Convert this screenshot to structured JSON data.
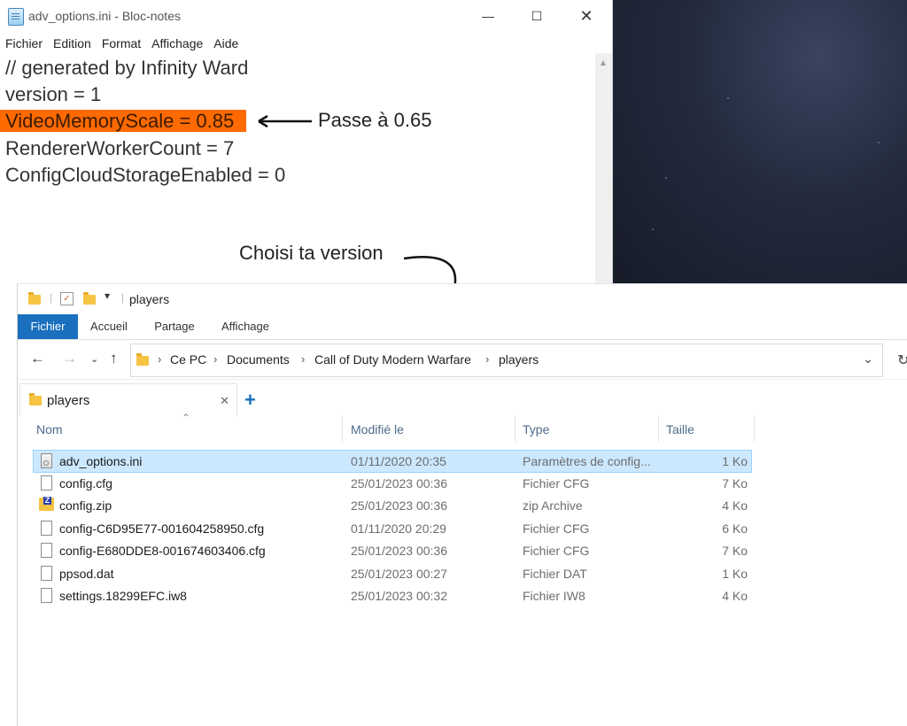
{
  "notepad": {
    "title": "adv_options.ini - Bloc-notes",
    "menu": [
      "Fichier",
      "Edition",
      "Format",
      "Affichage",
      "Aide"
    ],
    "lines": [
      "// generated by Infinity Ward",
      "version = 1",
      "VideoMemoryScale = 0.85",
      "RendererWorkerCount = 7",
      "ConfigCloudStorageEnabled = 0"
    ],
    "highlight_color": "#ff6a00"
  },
  "annotations": {
    "pass_value": "Passe à 0.65",
    "choose_version": "Choisi ta version"
  },
  "explorer": {
    "window_title": "players",
    "ribbon_tabs": [
      "Fichier",
      "Accueil",
      "Partage",
      "Affichage"
    ],
    "active_tab_color": "#1a6fbe",
    "breadcrumb": [
      "Ce PC",
      "Documents",
      "Call of Duty Modern Warfare",
      "players"
    ],
    "tab_label": "players",
    "columns": [
      "Nom",
      "Modifié le",
      "Type",
      "Taille"
    ],
    "files": [
      {
        "name": "adv_options.ini",
        "date": "01/11/2020 20:35",
        "type": "Paramètres de config...",
        "size": "1 Ko",
        "icon": "ini-file-icon"
      },
      {
        "name": "config.cfg",
        "date": "25/01/2023 00:36",
        "type": "Fichier CFG",
        "size": "7 Ko",
        "icon": "file-icon"
      },
      {
        "name": "config.zip",
        "date": "25/01/2023 00:36",
        "type": "zip Archive",
        "size": "4 Ko",
        "icon": "zip-icon"
      },
      {
        "name": "config-C6D95E77-001604258950.cfg",
        "date": "01/11/2020 20:29",
        "type": "Fichier CFG",
        "size": "6 Ko",
        "icon": "file-icon"
      },
      {
        "name": "config-E680DDE8-001674603406.cfg",
        "date": "25/01/2023 00:36",
        "type": "Fichier CFG",
        "size": "7 Ko",
        "icon": "file-icon"
      },
      {
        "name": "ppsod.dat",
        "date": "25/01/2023 00:27",
        "type": "Fichier DAT",
        "size": "1 Ko",
        "icon": "file-icon"
      },
      {
        "name": "settings.18299EFC.iw8",
        "date": "25/01/2023 00:32",
        "type": "Fichier IW8",
        "size": "4 Ko",
        "icon": "file-icon"
      }
    ]
  }
}
